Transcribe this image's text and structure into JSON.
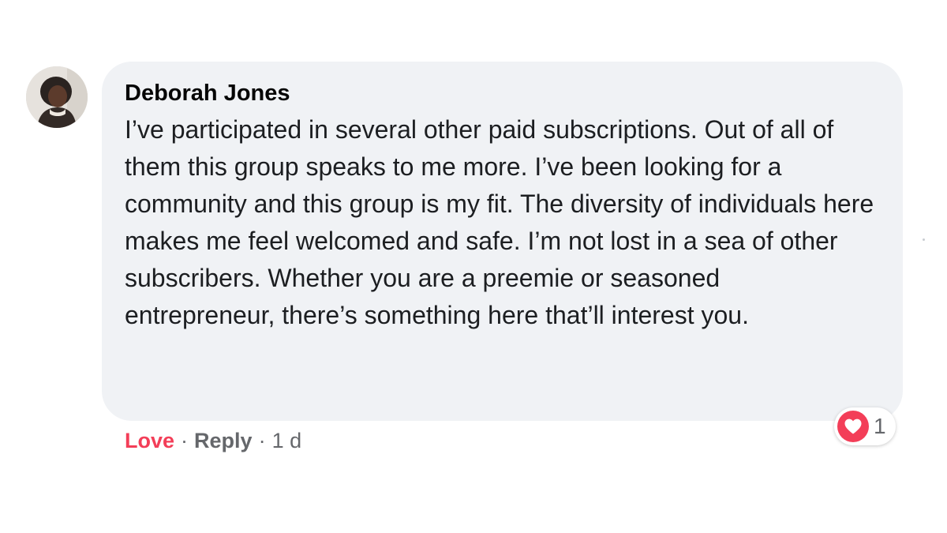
{
  "comment": {
    "author": "Deborah Jones",
    "text": "I’ve participated in several other paid subscriptions. Out of all of them this group speaks to me more. I’ve been looking for a community and this group is my fit. The diversity of individuals here makes me feel welcomed and safe. I’m not lost in a sea of other subscribers. Whether you are a preemie or seasoned entrepreneur, there’s something here that’ll interest you."
  },
  "actions": {
    "love_label": "Love",
    "separator": "·",
    "reply_label": "Reply",
    "timestamp": "1 d"
  },
  "reaction": {
    "icon": "heart-icon",
    "count": "1"
  },
  "colors": {
    "bubble": "#f0f2f5",
    "love": "#f33e58",
    "muted": "#65676b"
  }
}
